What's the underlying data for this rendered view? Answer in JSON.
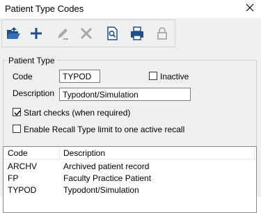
{
  "window": {
    "title": "Patient Type Codes"
  },
  "toolbar": {
    "buttons": [
      {
        "name": "open-icon",
        "enabled": true
      },
      {
        "name": "add-icon",
        "enabled": true
      },
      {
        "name": "edit-icon",
        "enabled": false
      },
      {
        "name": "delete-icon",
        "enabled": false
      },
      {
        "name": "preview-icon",
        "enabled": true
      },
      {
        "name": "print-icon",
        "enabled": true
      },
      {
        "name": "lock-icon",
        "enabled": false
      }
    ]
  },
  "form": {
    "group_label": "Patient Type",
    "code_label": "Code",
    "code_value": "TYPOD",
    "inactive_label": "Inactive",
    "inactive_checked": false,
    "description_label": "Description",
    "description_value": "Typodont/Simulation",
    "start_checks_label": "Start checks (when required)",
    "start_checks_checked": true,
    "recall_limit_label": "Enable Recall Type limit to one active recall",
    "recall_limit_checked": false
  },
  "list": {
    "columns": [
      "Code",
      "Description"
    ],
    "rows": [
      {
        "code": "ARCHV",
        "description": "Archived patient record"
      },
      {
        "code": "FP",
        "description": "Faculty Practice Patient"
      },
      {
        "code": "TYPOD",
        "description": "Typodont/Simulation"
      }
    ]
  },
  "colors": {
    "enabled_icon": "#1f4e8c",
    "disabled_icon": "#a0a0a0",
    "window_bg": "#f0f0f0"
  }
}
